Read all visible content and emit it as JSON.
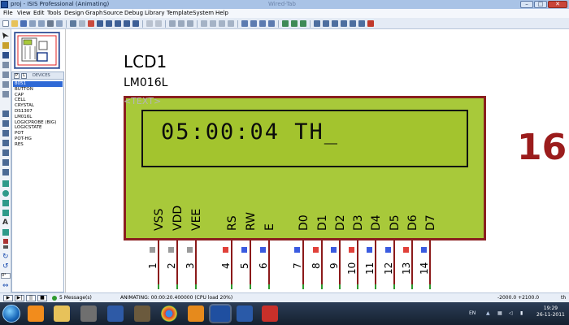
{
  "window": {
    "title": "proj - ISIS Professional (Animating)",
    "faded_caption": "Wired-Tab"
  },
  "menu": [
    "File",
    "View",
    "Edit",
    "Tools",
    "Design",
    "Graph",
    "Source",
    "Debug",
    "Library",
    "Template",
    "System",
    "Help"
  ],
  "device_panel": {
    "tabs": [
      "P",
      "L"
    ],
    "title": "DEVICES",
    "items": [
      "8051",
      "BUTTON",
      "CAP",
      "CELL",
      "CRYSTAL",
      "DS1307",
      "LM016L",
      "LOGICPROBE (BIG)",
      "LOGICSTATE",
      "POT",
      "POT-HG",
      "RES"
    ],
    "selected_index": 0
  },
  "schematic": {
    "ref": "LCD1",
    "model": "LM016L",
    "text_placeholder": "<TEXT>",
    "lcd_display": "05:00:04 TH_",
    "side_number": "16",
    "pins": [
      {
        "name": "VSS",
        "num": "1",
        "state": "gray"
      },
      {
        "name": "VDD",
        "num": "2",
        "state": "gray"
      },
      {
        "name": "VEE",
        "num": "3",
        "state": "gray"
      },
      {
        "name": "RS",
        "num": "4",
        "state": "red"
      },
      {
        "name": "RW",
        "num": "5",
        "state": "blue"
      },
      {
        "name": "E",
        "num": "6",
        "state": "blue"
      },
      {
        "name": "D0",
        "num": "7",
        "state": "blue"
      },
      {
        "name": "D1",
        "num": "8",
        "state": "red"
      },
      {
        "name": "D2",
        "num": "9",
        "state": "blue"
      },
      {
        "name": "D3",
        "num": "10",
        "state": "red"
      },
      {
        "name": "D4",
        "num": "11",
        "state": "blue"
      },
      {
        "name": "D5",
        "num": "12",
        "state": "blue"
      },
      {
        "name": "D6",
        "num": "13",
        "state": "red"
      },
      {
        "name": "D7",
        "num": "14",
        "state": "blue"
      }
    ]
  },
  "left_field": "0°",
  "status": {
    "messages": "5 Message(s)",
    "animating": "ANIMATING: 00:00:20.400000 (CPU load 20%)",
    "coords": "-2000.0  +2100.0",
    "unit": "th"
  },
  "taskbar": {
    "lang": "EN",
    "time": "19:29",
    "date": "26-11-2011"
  },
  "colors": {
    "pin_red": "#e0413a",
    "pin_blue": "#3a5be0",
    "pin_gray": "#9a9a9a"
  }
}
